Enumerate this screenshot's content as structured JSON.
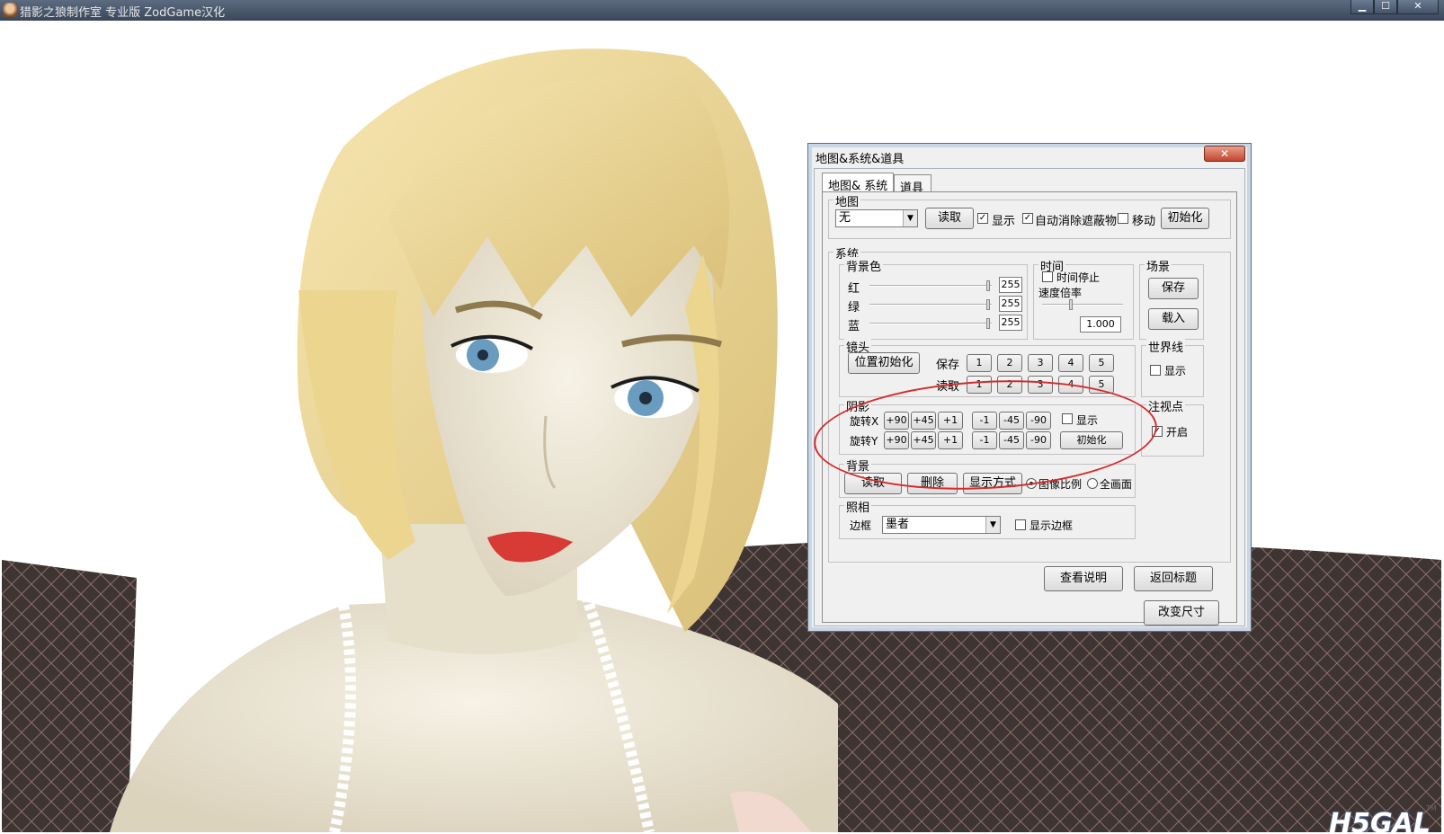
{
  "window": {
    "title": "猎影之狼制作室 专业版 ZodGame汉化",
    "min_icon": "minimize-icon",
    "max_icon": "maximize-icon",
    "close_icon": "close-icon",
    "min_glyph": "▁",
    "max_glyph": "☐",
    "close_glyph": "✕"
  },
  "watermark": {
    "text": "H5GAL",
    "tm": "TM"
  },
  "dialog": {
    "title": "地图&系统&道具",
    "close_glyph": "✕",
    "tabs": [
      "地图& 系统",
      "道具"
    ],
    "map": {
      "group_label": "地图",
      "select_value": "无",
      "read_button": "读取",
      "show_label": "显示",
      "show_checked": "✓",
      "auto_remove_label": "自动消除遮蔽物",
      "auto_remove_checked": "✓",
      "move_label": "移动",
      "init_button": "初始化"
    },
    "system": {
      "group_label": "系统",
      "bgcolor": {
        "group_label": "背景色",
        "rows": [
          {
            "label": "红",
            "value": "255",
            "level": 1.0
          },
          {
            "label": "绿",
            "value": "255",
            "level": 1.0
          },
          {
            "label": "蓝",
            "value": "255",
            "level": 1.0
          }
        ]
      },
      "time": {
        "group_label": "时间",
        "stop_label": "时间停止",
        "speed_label": "速度倍率",
        "speed_value": "1.000"
      },
      "scene": {
        "group_label": "场景",
        "save_button": "保存",
        "load_button": "载入"
      },
      "camera": {
        "group_label": "镜头",
        "init_button": "位置初始化",
        "save_label": "保存",
        "read_label": "读取",
        "slots": [
          "1",
          "2",
          "3",
          "4",
          "5"
        ]
      },
      "worldline": {
        "group_label": "世界线",
        "show_label": "显示"
      },
      "gaze": {
        "group_label": "注视点",
        "enable_label": "开启",
        "enable_checked": "✓"
      },
      "shadow": {
        "group_label": "阴影",
        "rot_x_label": "旋转X",
        "rot_y_label": "旋转Y",
        "pos_steps": [
          "+90",
          "+45",
          "+1"
        ],
        "neg_steps": [
          "-1",
          "-45",
          "-90"
        ],
        "show_label": "显示",
        "init_button": "初始化"
      },
      "background": {
        "group_label": "背景",
        "read_button": "读取",
        "delete_button": "删除",
        "display_mode_button": "显示方式",
        "ratio_label": "图像比例",
        "full_label": "全画面"
      },
      "photo": {
        "group_label": "照相",
        "frame_label": "边框",
        "frame_value": "墨者",
        "show_frame_label": "显示边框"
      }
    },
    "help_button": "查看说明",
    "back_button": "返回标题",
    "resize_button": "改变尺寸"
  },
  "colors": {
    "annotation": "#d42c2c",
    "hair": "#f1dca0",
    "skin": "#f2ede0",
    "lips": "#d83a36",
    "eyes": "#6a9cc0",
    "sofa": "#3e3432"
  }
}
